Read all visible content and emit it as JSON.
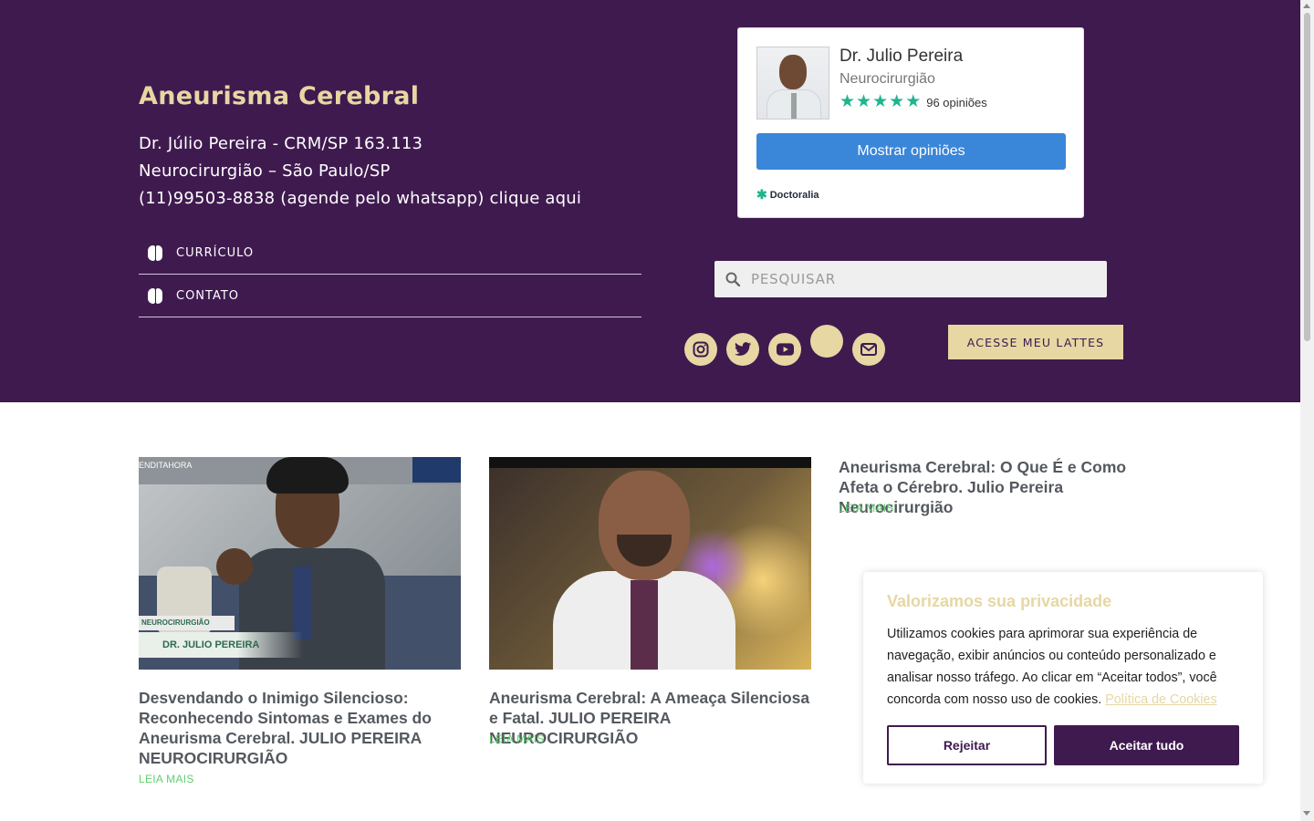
{
  "header": {
    "title": "Aneurisma Cerebral",
    "info_lines": [
      "Dr. Júlio Pereira - CRM/SP 163.113",
      "Neurocirurgião – São Paulo/SP",
      "(11)99503-8838 (agende pelo whatsapp) clique aqui"
    ],
    "nav": [
      {
        "label": "CURRÍCULO",
        "icon": "brain-icon"
      },
      {
        "label": "CONTATO",
        "icon": "brain-icon"
      }
    ]
  },
  "widget": {
    "name": "Dr. Julio Pereira",
    "specialty": "Neurocirurgião",
    "rating": 5,
    "reviews": "96 opiniões",
    "button": "Mostrar opiniões",
    "brand": "Doctoralia",
    "star_color": "#1fb58f",
    "button_color": "#3a86d9"
  },
  "search": {
    "placeholder": "PESQUISAR"
  },
  "social": [
    "instagram-icon",
    "twitter-icon",
    "youtube-icon",
    "blank-icon",
    "envelope-icon"
  ],
  "lattes_button": "ACESSE MEU LATTES",
  "posts": [
    {
      "title": "Desvendando o Inimigo Silencioso: Reconhecendo Sintomas e Exames do Aneurisma Cerebral. JULIO PEREIRA NEUROCIRURGIÃO",
      "read_more": "LEIA MAIS",
      "thumb_caption_small": "NEUROCIRURGIÃO",
      "thumb_caption_big": "DR. JULIO PEREIRA",
      "thumb_corner": "ENDITAHORA"
    },
    {
      "title": "Aneurisma Cerebral: A Ameaça Silenciosa e Fatal. JULIO PEREIRA NEUROCIRURGIÃO",
      "read_more": "LEIA MAIS"
    },
    {
      "title": "Aneurisma Cerebral: O Que É e Como Afeta o Cérebro. Julio Pereira Neurocirurgião",
      "read_more": "LEIA MAIS"
    }
  ],
  "cookie": {
    "title": "Valorizamos sua privacidade",
    "text": "Utilizamos cookies para aprimorar sua experiência de navegação, exibir anúncios ou conteúdo personalizado e analisar nosso tráfego. Ao clicar em “Aceitar todos”, você concorda com nosso uso de cookies.",
    "link": "Política de Cookies",
    "reject": "Rejeitar",
    "accept": "Aceitar tudo"
  },
  "colors": {
    "brand_purple": "#3f1a4f",
    "accent_gold": "#e6d7a3",
    "read_more_green": "#61ce70"
  }
}
